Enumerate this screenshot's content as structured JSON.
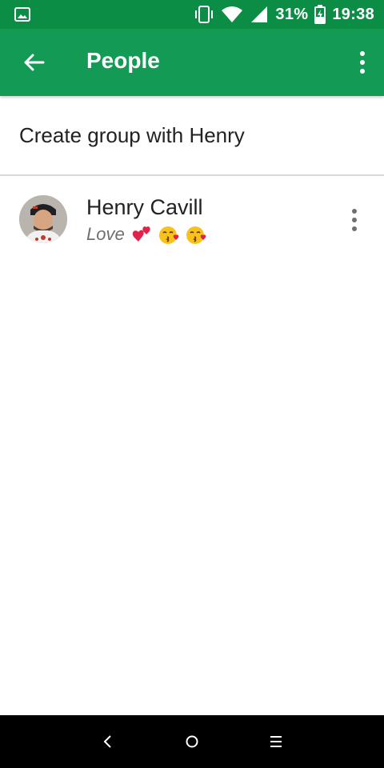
{
  "status_bar": {
    "battery_percent": "31%",
    "time": "19:38",
    "icons": [
      "image-icon",
      "vibrate-icon",
      "wifi-icon",
      "signal-icon",
      "battery-charging-icon"
    ]
  },
  "app_bar": {
    "title": "People",
    "back_icon": "arrow-left-icon",
    "menu_icon": "more-vert-icon"
  },
  "create_group": {
    "label": "Create group with Henry"
  },
  "people": [
    {
      "name": "Henry Cavill",
      "status_text": "Love",
      "status_emojis": [
        "two-hearts-emoji",
        "kissing-face-emoji",
        "kissing-face-emoji"
      ]
    }
  ],
  "navigation_bar": {
    "icons": [
      "nav-back-icon",
      "nav-home-icon",
      "nav-recents-icon"
    ]
  },
  "colors": {
    "status_bar": "#0c8d46",
    "app_bar": "#139b55",
    "divider": "#d8d8d8"
  }
}
